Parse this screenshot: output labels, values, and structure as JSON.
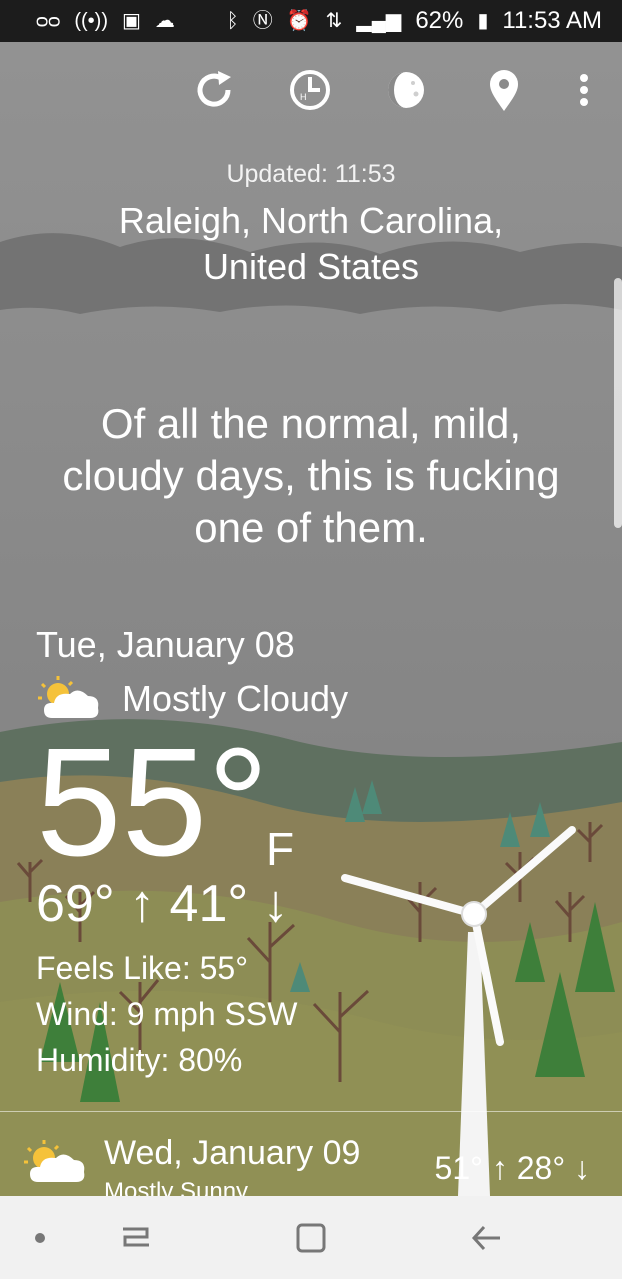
{
  "status_bar": {
    "icons_left": [
      "voicemail-icon",
      "podcast-icon",
      "image-icon",
      "cloud-icon"
    ],
    "icons_right": [
      "bluetooth-icon",
      "nfc-icon",
      "alarm-icon",
      "data-icon",
      "signal-icon"
    ],
    "battery": "62%",
    "time": "11:53 AM"
  },
  "toolbar": {
    "buttons": [
      "refresh-icon",
      "hourly-clock-icon",
      "moon-phase-icon",
      "location-pin-icon",
      "more-vert-icon"
    ]
  },
  "header": {
    "updated": "Updated: 11:53",
    "location_line1": "Raleigh, North Carolina,",
    "location_line2": "United States"
  },
  "quote": {
    "line1": "Of all the normal, mild,",
    "line2": "cloudy days, this is fucking",
    "line3": "one of them."
  },
  "today": {
    "date": "Tue, January 08",
    "condition": "Mostly Cloudy",
    "temperature": "55°",
    "unit": "F",
    "hi_lo": "69° ↑ 41° ↓",
    "feels_like": "Feels Like: 55°",
    "wind": "Wind: 9 mph SSW",
    "humidity": "Humidity: 80%"
  },
  "next_day": {
    "date": "Wed, January 09",
    "condition": "Mostly Sunny",
    "hi_lo": "51° ↑ 28° ↓"
  },
  "nav_bar": {
    "buttons": [
      "dot-icon",
      "recents-icon",
      "home-icon",
      "back-icon"
    ]
  },
  "colors": {
    "sky": "#8a8a8a",
    "cloud_band": "#6f6f6f",
    "hills": "#8a8e5c",
    "trees_green": "#3e7f3a",
    "status_bar": "#1c1c1c",
    "nav_bar": "#f1f1f1"
  }
}
